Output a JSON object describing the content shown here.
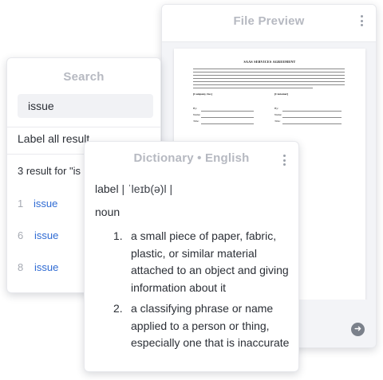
{
  "file_preview": {
    "title": "File Preview",
    "document": {
      "heading": "SAAS SERVICES AGREEMENT",
      "company_label": "[Company, Inc.]",
      "customer_label": "[Customer]",
      "signature_fields": [
        "By:",
        "Name:",
        "Title:"
      ]
    }
  },
  "search_panel": {
    "title": "Search",
    "query": "issue",
    "label_all": "Label all result",
    "result_count": "3 result for \"is",
    "results": [
      {
        "num": "1",
        "term": "issue"
      },
      {
        "num": "6",
        "term": "issue"
      },
      {
        "num": "8",
        "term": "issue"
      }
    ]
  },
  "dictionary": {
    "title": "Dictionary • English",
    "word": "label",
    "pronunciation": "| ˈleɪb(ə)l |",
    "part_of_speech": "noun",
    "definitions": [
      {
        "num": "1.",
        "text": "a small piece of paper, fabric, plastic, or similar material attached to an object and giving information about it"
      },
      {
        "num": "2.",
        "text": "a classifying phrase or name applied to a person or thing, especially one that is inaccurate"
      }
    ]
  },
  "icons": {
    "menu": "kebab-menu-icon",
    "next": "arrow-right-circle-icon"
  }
}
